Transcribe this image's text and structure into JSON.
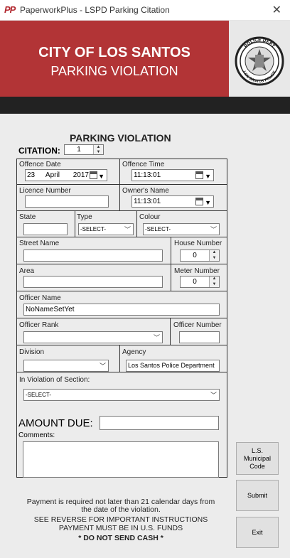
{
  "window": {
    "app_icon": "PP",
    "title": "PaperworkPlus - LSPD Parking Citation",
    "close": "✕"
  },
  "banner": {
    "city": "CITY OF LOS SANTOS",
    "subtitle": "PARKING VIOLATION",
    "badge_top": "POLICE DEPT",
    "badge_bottom": "LOS SANTOS POLICE"
  },
  "form": {
    "heading": "PARKING VIOLATION",
    "citation_label": "CITATION:",
    "citation_value": "1",
    "offence_date_label": "Offence Date",
    "offence_date_day": "23",
    "offence_date_month": "April",
    "offence_date_year": "2017",
    "offence_time_label": "Offence Time",
    "offence_time_value": "11:13:01",
    "licence_label": "Licence Number",
    "licence_value": "",
    "owner_label": "Owner's Name",
    "owner_time_value": "11:13:01",
    "state_label": "State",
    "state_value": "",
    "type_label": "Type",
    "type_value": "-SELECT-",
    "colour_label": "Colour",
    "colour_value": "-SELECT-",
    "street_label": "Street Name",
    "street_value": "",
    "house_label": "House Number",
    "house_value": "0",
    "area_label": "Area",
    "area_value": "",
    "meter_label": "Meter Number",
    "meter_value": "0",
    "officer_name_label": "Officer Name",
    "officer_name_value": "NoNameSetYet",
    "officer_rank_label": "Officer Rank",
    "officer_rank_value": "",
    "officer_number_label": "Officer Number",
    "officer_number_value": "",
    "division_label": "Division",
    "division_value": "",
    "agency_label": "Agency",
    "agency_value": "Los Santos Police Department",
    "violation_label": "In Violation of Section:",
    "violation_value": "-SELECT-",
    "amount_label": "AMOUNT DUE:",
    "amount_value": "",
    "comments_label": "Comments:",
    "comments_value": ""
  },
  "buttons": {
    "municipal_code": "L.S. Municipal Code",
    "submit": "Submit",
    "exit": "Exit"
  },
  "footer": {
    "line1": "Payment is required not later than 21 calendar days from",
    "line2": "the date of the violation.",
    "line3": "SEE REVERSE FOR IMPORTANT INSTRUCTIONS",
    "line4": "PAYMENT MUST BE IN U.S. FUNDS",
    "line5": "*  DO NOT SEND CASH  *"
  },
  "colors": {
    "banner_red": "#b23436",
    "dark_bar": "#222222",
    "form_background": "#ececec"
  }
}
